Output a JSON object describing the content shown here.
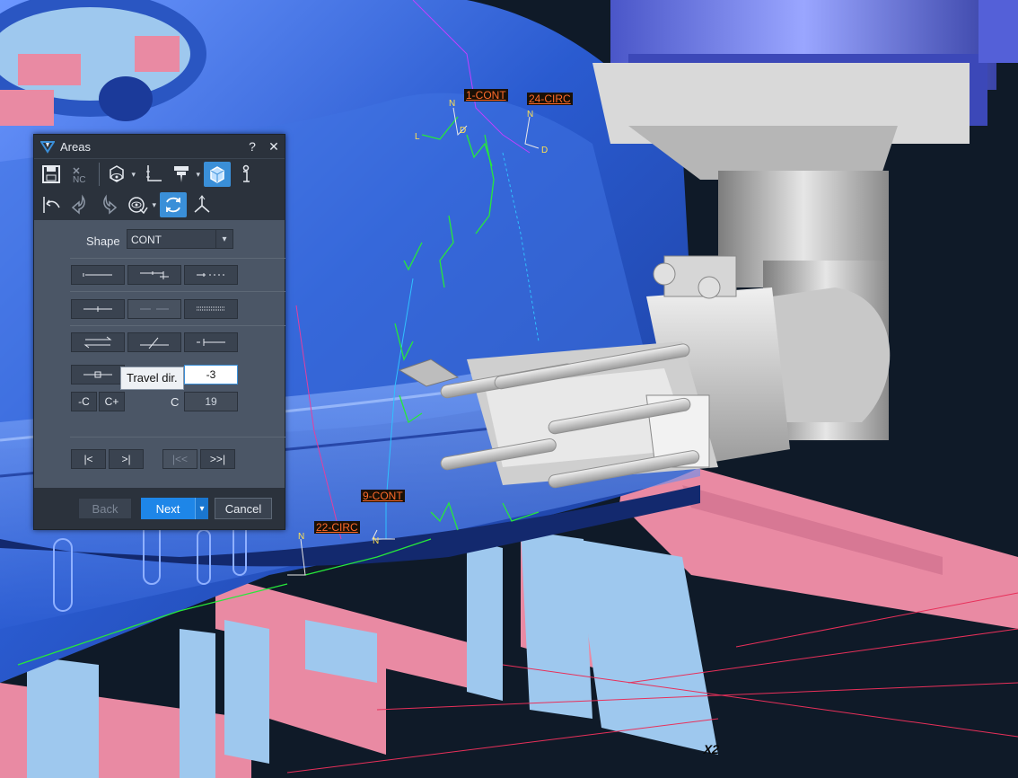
{
  "dialog": {
    "title": "Areas",
    "help": "?",
    "close": "✕",
    "toolbar1": [
      {
        "icon": "save-icon"
      },
      {
        "icon": "nc-icon",
        "text": "NC"
      },
      {
        "icon": "view-cube-icon"
      },
      {
        "icon": "axis-icon"
      },
      {
        "icon": "tool-holder-icon"
      },
      {
        "icon": "solid-cube-icon"
      },
      {
        "icon": "info-icon"
      }
    ],
    "toolbar2": [
      {
        "icon": "back-path-icon"
      },
      {
        "icon": "undo-arrow-icon"
      },
      {
        "icon": "redo-arrow-icon"
      },
      {
        "icon": "visibility-icon"
      },
      {
        "icon": "refresh-icon"
      },
      {
        "icon": "coordinate-axes-icon"
      }
    ],
    "shape_label": "Shape",
    "shape_value": "CONT",
    "travel_dir_tooltip": "Travel dir.",
    "travel_dir_value": "-3",
    "c_minus": "-C",
    "c_plus": "C+",
    "c_label": "C",
    "c_value": "19",
    "nav": {
      "first": "|<",
      "last": ">|",
      "first_dis": "|<<",
      "last2": ">>|"
    },
    "footer": {
      "back": "Back",
      "next": "Next",
      "cancel": "Cancel"
    }
  },
  "viewport_labels": {
    "l1": "1-CONT",
    "l24": "24-CIRC",
    "l9": "9-CONT",
    "l22": "22-CIRC",
    "x2": "X2"
  },
  "colors": {
    "accent": "#1e86e8",
    "part_blue": "#2f63d6",
    "fixture_pink": "#e98aa3",
    "fixture_lightblue": "#9ec8ee",
    "toolpath_green": "#27e83b",
    "label_orange": "#ff6a2a"
  }
}
